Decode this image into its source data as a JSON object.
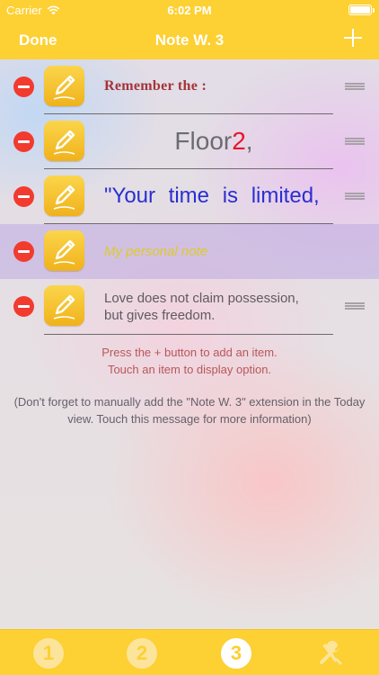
{
  "status": {
    "carrier": "Carrier",
    "time": "6:02 PM"
  },
  "nav": {
    "done_label": "Done",
    "title": "Note W. 3"
  },
  "items": [
    {
      "text": "Remember the :"
    },
    {
      "text_a": "Floor ",
      "text_b": "2",
      "text_c": ","
    },
    {
      "text": "\"Your time is limited,"
    },
    {
      "text": "My personal note"
    },
    {
      "text": "Love does not claim possession, but gives freedom."
    }
  ],
  "hint": {
    "line1": "Press the + button to add an item.",
    "line2": "Touch an item to display option."
  },
  "note": "(Don't forget to manually add the \"Note W. 3\" extension in the Today view. Touch this message for more information)",
  "tabs": [
    {
      "label": "1",
      "state": "inactive"
    },
    {
      "label": "2",
      "state": "inactive"
    },
    {
      "label": "3",
      "state": "active"
    },
    {
      "icon": "tools-icon",
      "state": "inactive"
    }
  ],
  "colors": {
    "accent": "#fdd033",
    "delete": "#f23a2f"
  }
}
